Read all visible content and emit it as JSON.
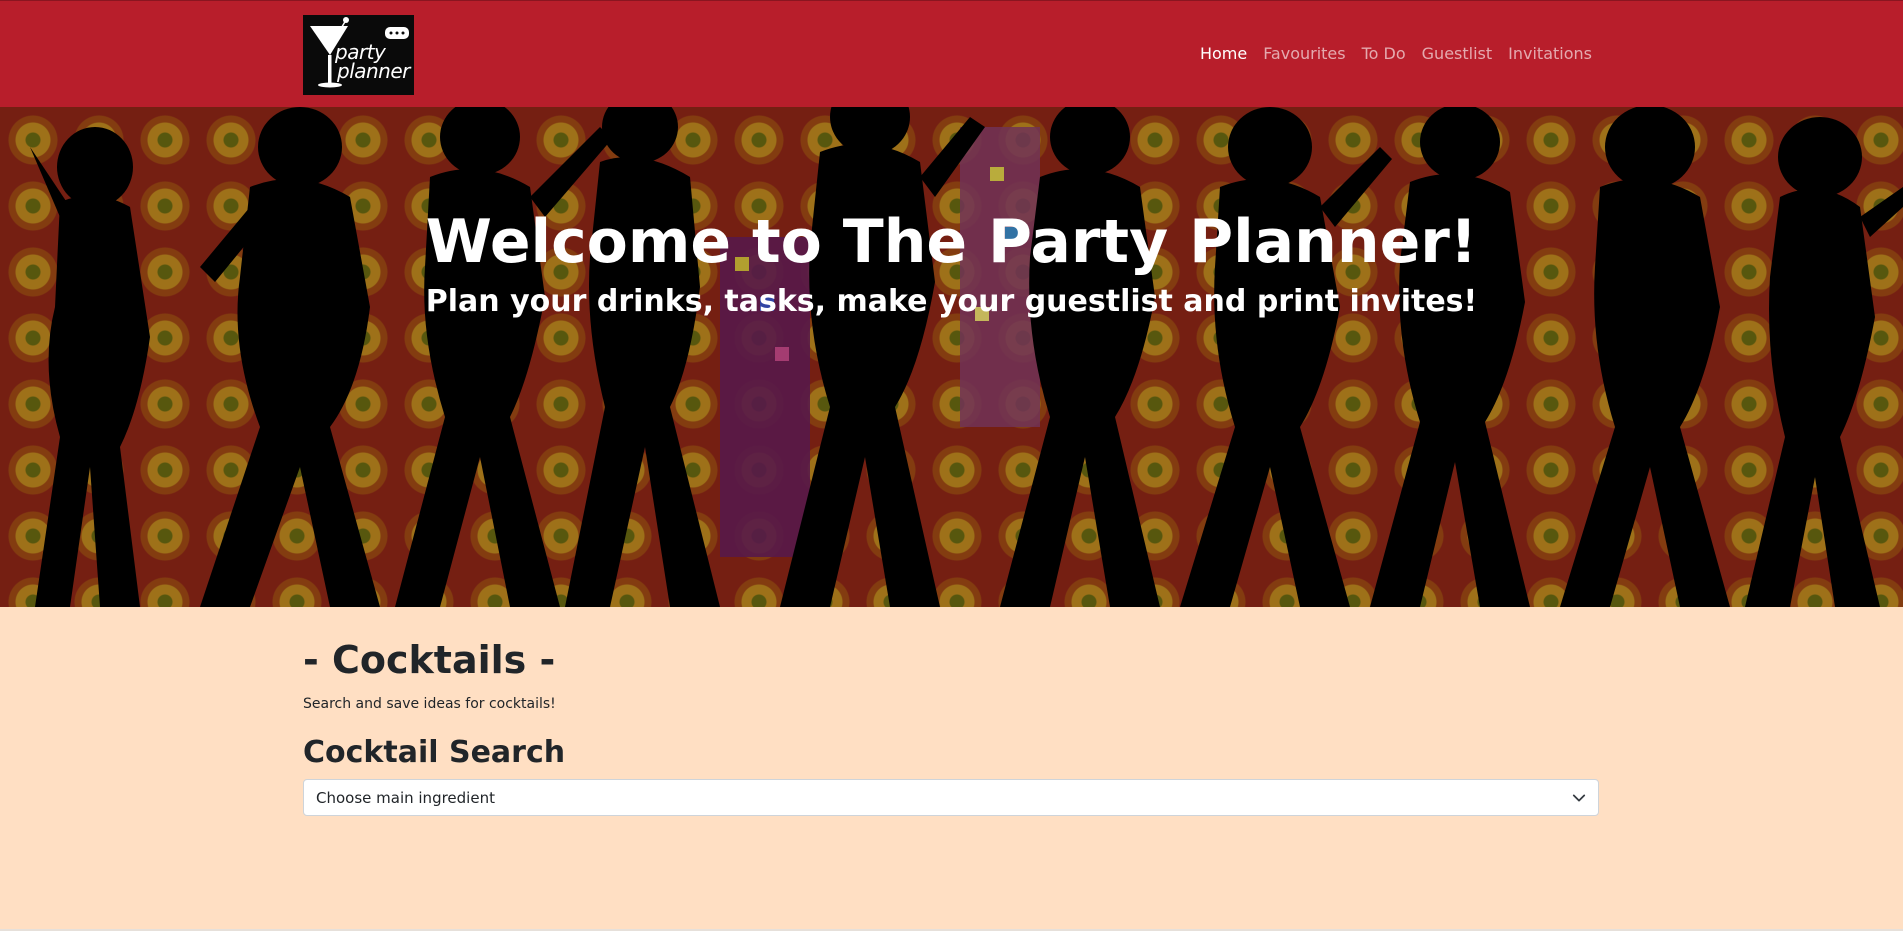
{
  "brand": {
    "logo_line1": "party",
    "logo_line2": "planner"
  },
  "nav": {
    "items": [
      {
        "label": "Home",
        "active": true
      },
      {
        "label": "Favourites",
        "active": false
      },
      {
        "label": "To Do",
        "active": false
      },
      {
        "label": "Guestlist",
        "active": false
      },
      {
        "label": "Invitations",
        "active": false
      }
    ]
  },
  "hero": {
    "title": "Welcome to The Party Planner!",
    "subtitle": "Plan your drinks, tasks, make your guestlist and print invites!"
  },
  "cocktails": {
    "heading": "- Cocktails -",
    "description": "Search and save ideas for cocktails!",
    "search_heading": "Cocktail Search",
    "select_value": "Choose main ingredient"
  },
  "colors": {
    "navbar": "#b81e2b",
    "page_background": "#ffdfc3",
    "hero_pattern_red": "#8f2617",
    "hero_pattern_gold": "#c18a1f",
    "silhouette": "#000000"
  },
  "icons": {
    "logo": "martini-glass-icon",
    "select_caret": "chevron-down-icon"
  }
}
